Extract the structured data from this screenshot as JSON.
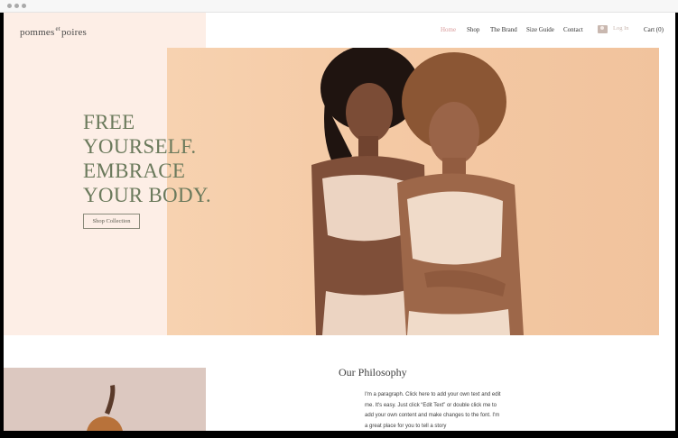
{
  "site": {
    "logo_main": "pommes",
    "logo_sup": "et",
    "logo_end": "poires"
  },
  "nav": {
    "items": [
      {
        "label": "Home",
        "active": true
      },
      {
        "label": "Shop",
        "active": false
      },
      {
        "label": "The Brand",
        "active": false
      },
      {
        "label": "Size Guide",
        "active": false
      },
      {
        "label": "Contact",
        "active": false
      }
    ],
    "login_label": "Log In",
    "cart_label": "Cart (0)"
  },
  "hero": {
    "headline_lines": [
      "FREE",
      "YOURSELF.",
      "EMBRACE",
      "YOUR BODY."
    ],
    "cta_label": "Shop Collection"
  },
  "philosophy": {
    "title": "Our Philosophy",
    "paragraph_lines": [
      "I'm a paragraph. Click here to add your own text and edit",
      "me. It's easy. Just click “Edit Text” or double click me to",
      "add your own content and make changes to the font. I'm",
      "a great place for you to tell a story"
    ]
  },
  "colors": {
    "accent": "#d99a9a",
    "headline": "#6b7a5c",
    "panel": "#fdeee6",
    "hero_bg": "#f4c9a4"
  }
}
